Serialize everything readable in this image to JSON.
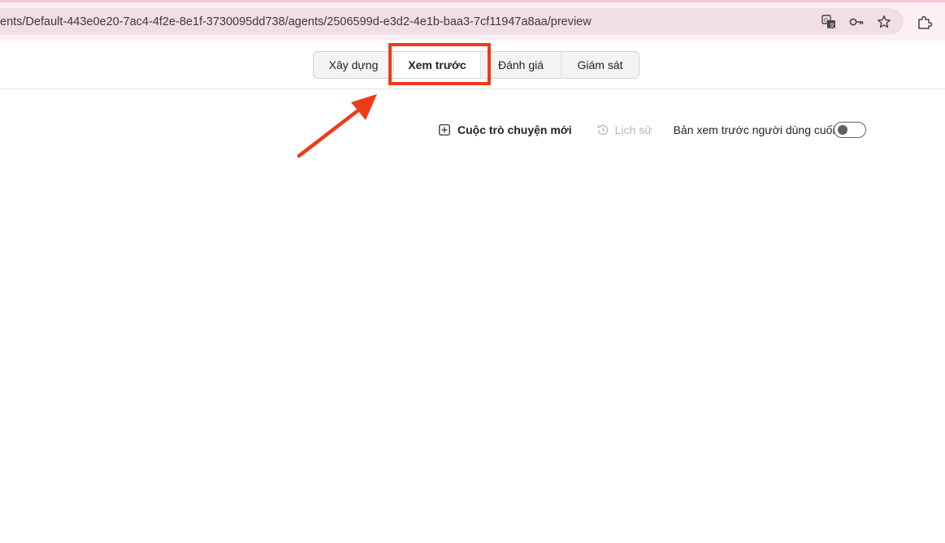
{
  "browser": {
    "url": "ents/Default-443e0e20-7ac4-4f2e-8e1f-3730095dd738/agents/2506599d-e3d2-4e1b-baa3-7cf11947a8aa/preview",
    "icons": [
      "translate-icon",
      "key-icon",
      "star-icon",
      "extensions-icon"
    ]
  },
  "tabs": [
    {
      "label": "Xây dựng"
    },
    {
      "label": "Xem trước",
      "selected": true
    },
    {
      "label": "Đánh giá"
    },
    {
      "label": "Giám sát"
    }
  ],
  "toolbar": {
    "new_chat_label": "Cuộc trò chuyện mới",
    "history_label": "Lịch sử",
    "end_user_preview_label": "Bản xem trước người dùng cuối",
    "end_user_preview_on": false
  },
  "annotation": {
    "highlight_color": "#ee3a1c"
  }
}
